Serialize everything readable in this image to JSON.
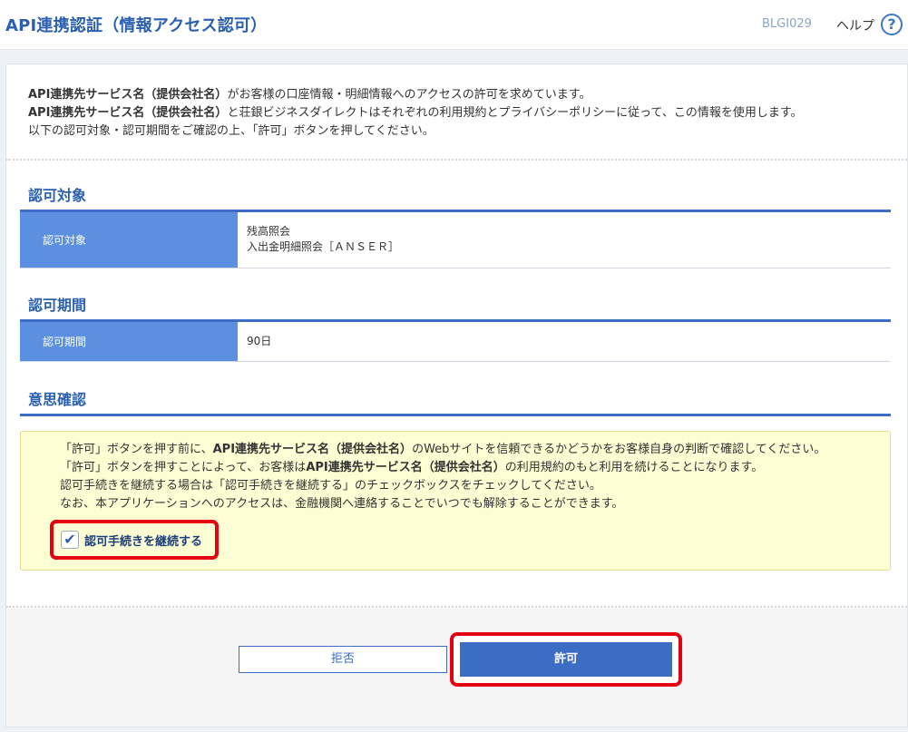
{
  "header": {
    "title": "API連携認証（情報アクセス認可）",
    "screen_id": "BLGI029",
    "help_label": "ヘルプ",
    "help_icon_glyph": "?"
  },
  "intro": {
    "line1_bold": "API連携先サービス名（提供会社名）",
    "line1_rest": "がお客様の口座情報・明細情報へのアクセスの許可を求めています。",
    "line2_bold": "API連携先サービス名（提供会社名）",
    "line2_rest": "と荘銀ビジネスダイレクトはそれぞれの利用規約とプライバシーポリシーに従って、この情報を使用します。",
    "line3": "以下の認可対象・認可期間をご確認の上、「許可」ボタンを押してください。"
  },
  "scope": {
    "section_title": "認可対象",
    "label": "認可対象",
    "values": [
      "残高照会",
      "入出金明細照会［ＡＮＳＥＲ］"
    ]
  },
  "period": {
    "section_title": "認可期間",
    "label": "認可期間",
    "value": "90日"
  },
  "consent": {
    "section_title": "意思確認",
    "line1_pre": "「許可」ボタンを押す前に、",
    "line1_bold": "API連携先サービス名（提供会社名）",
    "line1_post": "のWebサイトを信頼できるかどうかをお客様自身の判断で確認してください。",
    "line2_pre": "「許可」ボタンを押すことによって、お客様は",
    "line2_bold": "API連携先サービス名（提供会社名）",
    "line2_post": "の利用規約のもと利用を続けることになります。",
    "line3": "認可手続きを継続する場合は「認可手続きを継続する」のチェックボックスをチェックしてください。",
    "line4": "なお、本アプリケーションへのアクセスは、金融機関へ連絡することでいつでも解除することができます。",
    "checkbox_label": "認可手続きを継続する",
    "checkbox_mark": "✔",
    "checked": true
  },
  "buttons": {
    "reject_label": "拒否",
    "allow_label": "許可"
  },
  "colors": {
    "accent": "#3c6dc5",
    "label_bg": "#5b8fe0",
    "highlight": "#e50012",
    "notice_bg": "#fefed5"
  }
}
